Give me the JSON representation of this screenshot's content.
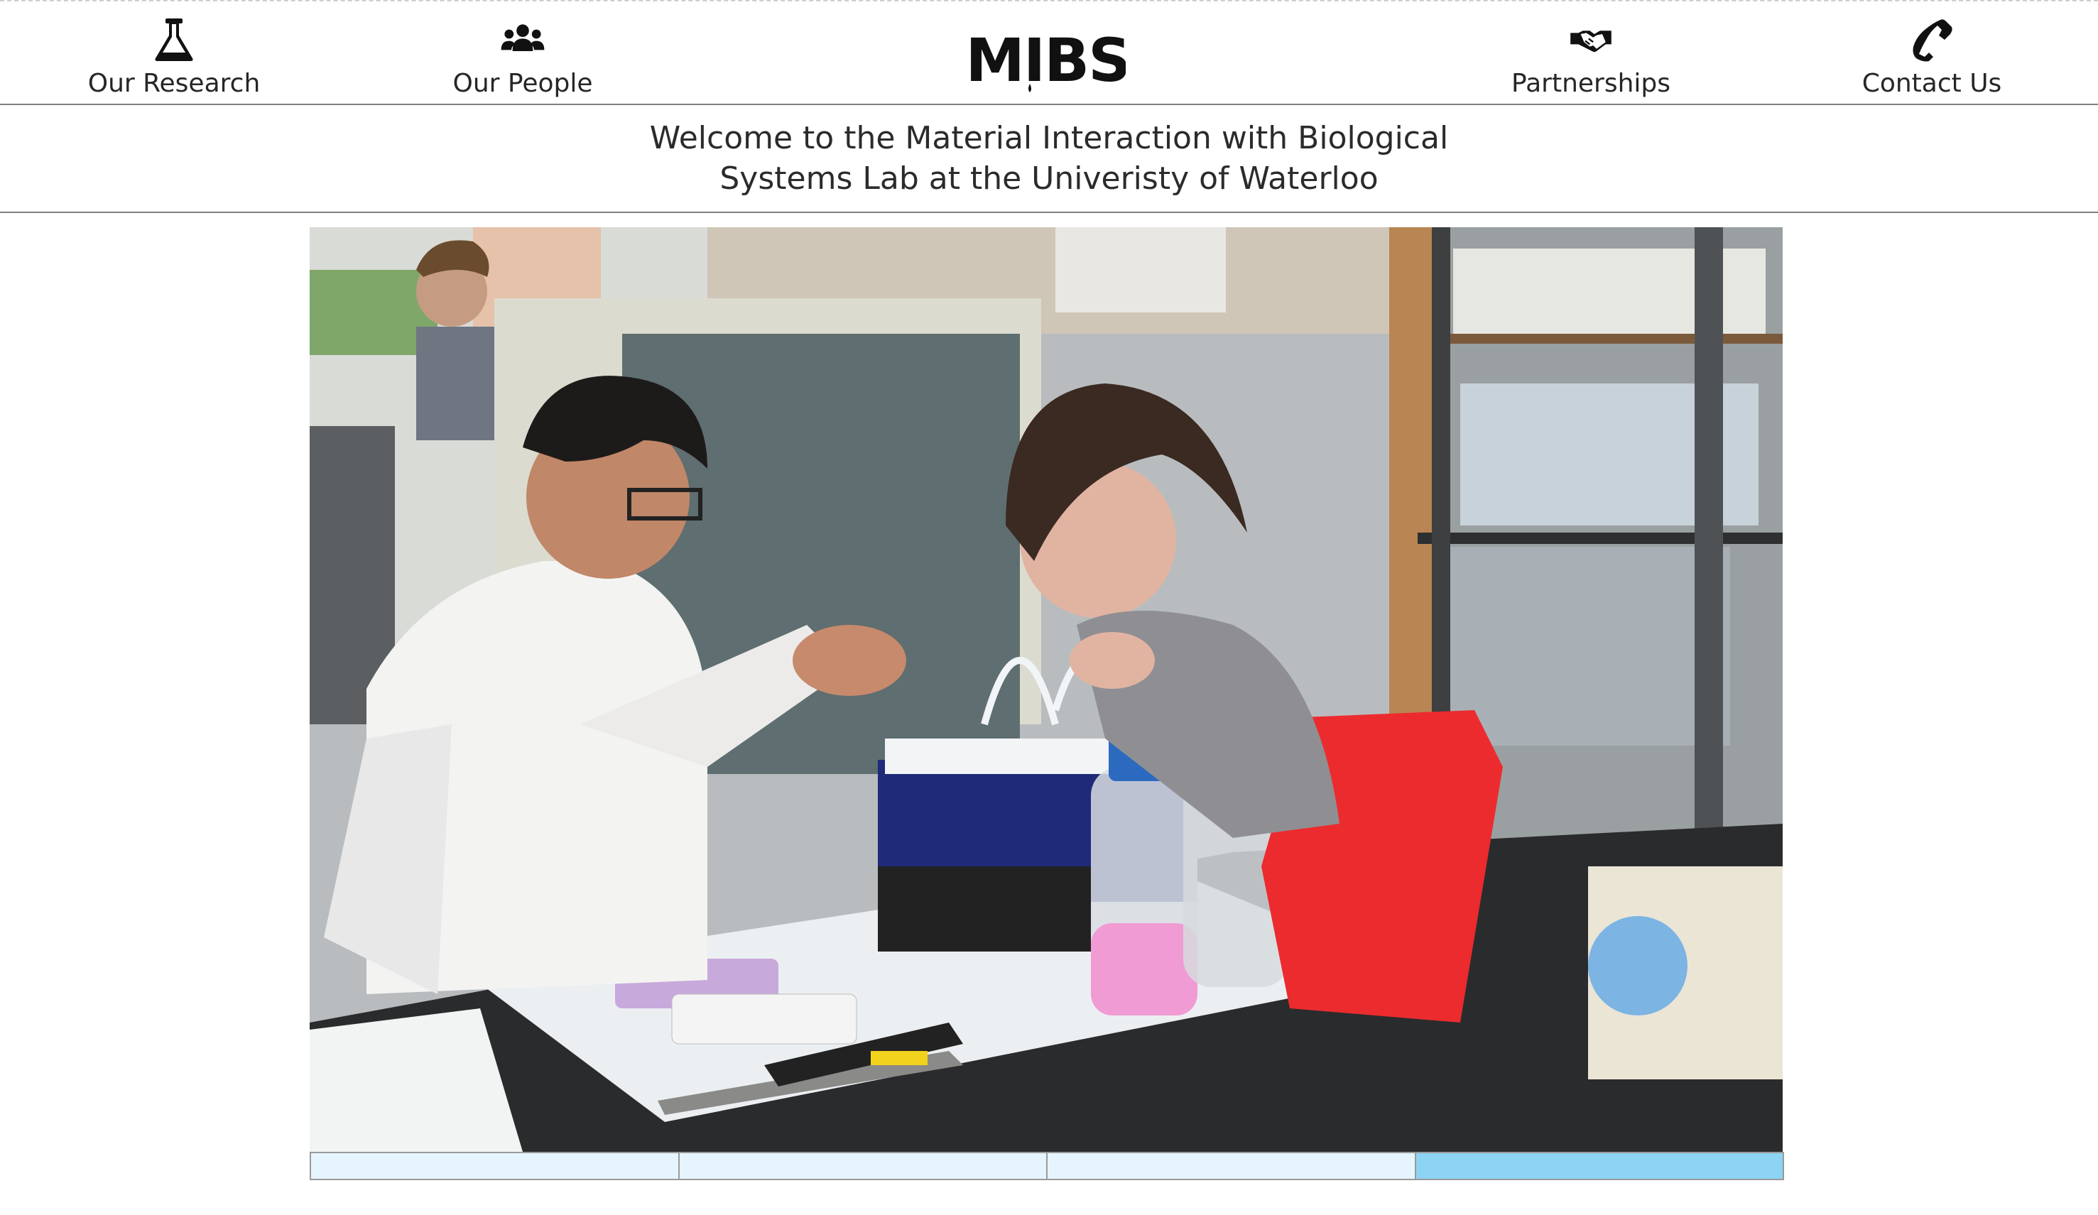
{
  "nav": {
    "items": [
      {
        "label": "Our Research",
        "icon": "flask-icon"
      },
      {
        "label": "Our People",
        "icon": "users-icon"
      },
      {
        "label": "Partnerships",
        "icon": "handshake-icon"
      },
      {
        "label": "Contact Us",
        "icon": "phone-icon"
      }
    ],
    "logo_text": "MIBS"
  },
  "welcome": {
    "line1": "Welcome to the Material Interaction with Biological",
    "line2": "Systems Lab at the Univeristy of Waterloo"
  },
  "slider": {
    "count": 4,
    "active_index": 3
  },
  "colors": {
    "slider_inactive": "#e6f5fd",
    "slider_active": "#8dd3f3",
    "divider": "#808080"
  }
}
